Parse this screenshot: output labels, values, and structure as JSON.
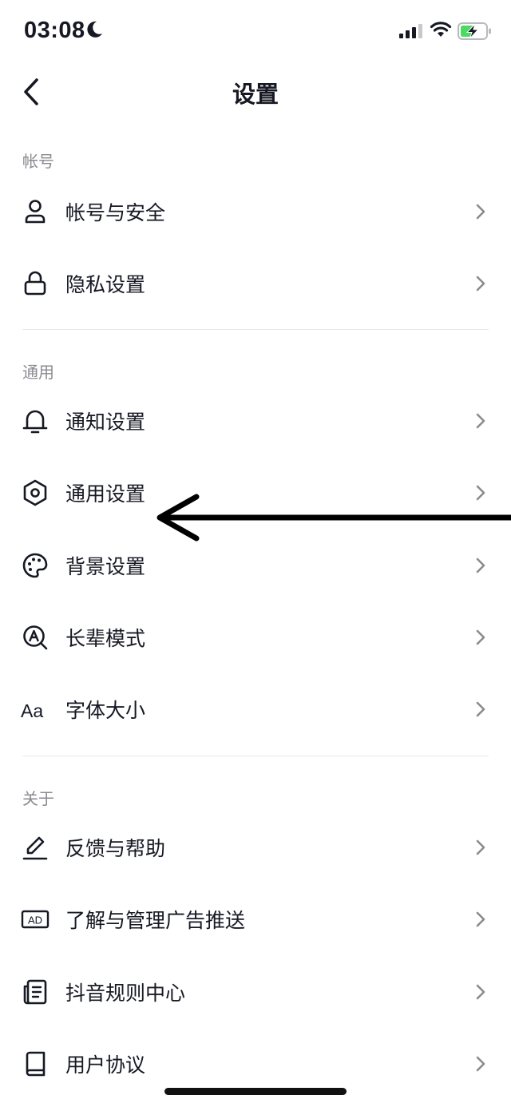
{
  "status_bar": {
    "time": "03:08"
  },
  "nav": {
    "title": "设置"
  },
  "sections": {
    "account": {
      "title": "帐号",
      "items": [
        "帐号与安全",
        "隐私设置"
      ]
    },
    "general": {
      "title": "通用",
      "items": [
        "通知设置",
        "通用设置",
        "背景设置",
        "长辈模式",
        "字体大小"
      ]
    },
    "about": {
      "title": "关于",
      "items": [
        "反馈与帮助",
        "了解与管理广告推送",
        "抖音规则中心",
        "用户协议"
      ]
    }
  },
  "icons": {
    "account_security": "user-icon",
    "privacy": "lock-icon",
    "notifications": "bell-icon",
    "general": "gear-icon",
    "background": "palette-icon",
    "elder_mode": "elder-mode-icon",
    "font_size": "font-size-icon",
    "font_size_glyph": "Aa",
    "feedback": "pencil-icon",
    "ads": "ad-icon",
    "ads_glyph": "AD",
    "rules": "document-icon",
    "agreement": "book-icon"
  },
  "colors": {
    "text": "#161823",
    "secondary": "#8a8b91",
    "divider": "#e9e9eb",
    "battery": "#4cd964"
  }
}
